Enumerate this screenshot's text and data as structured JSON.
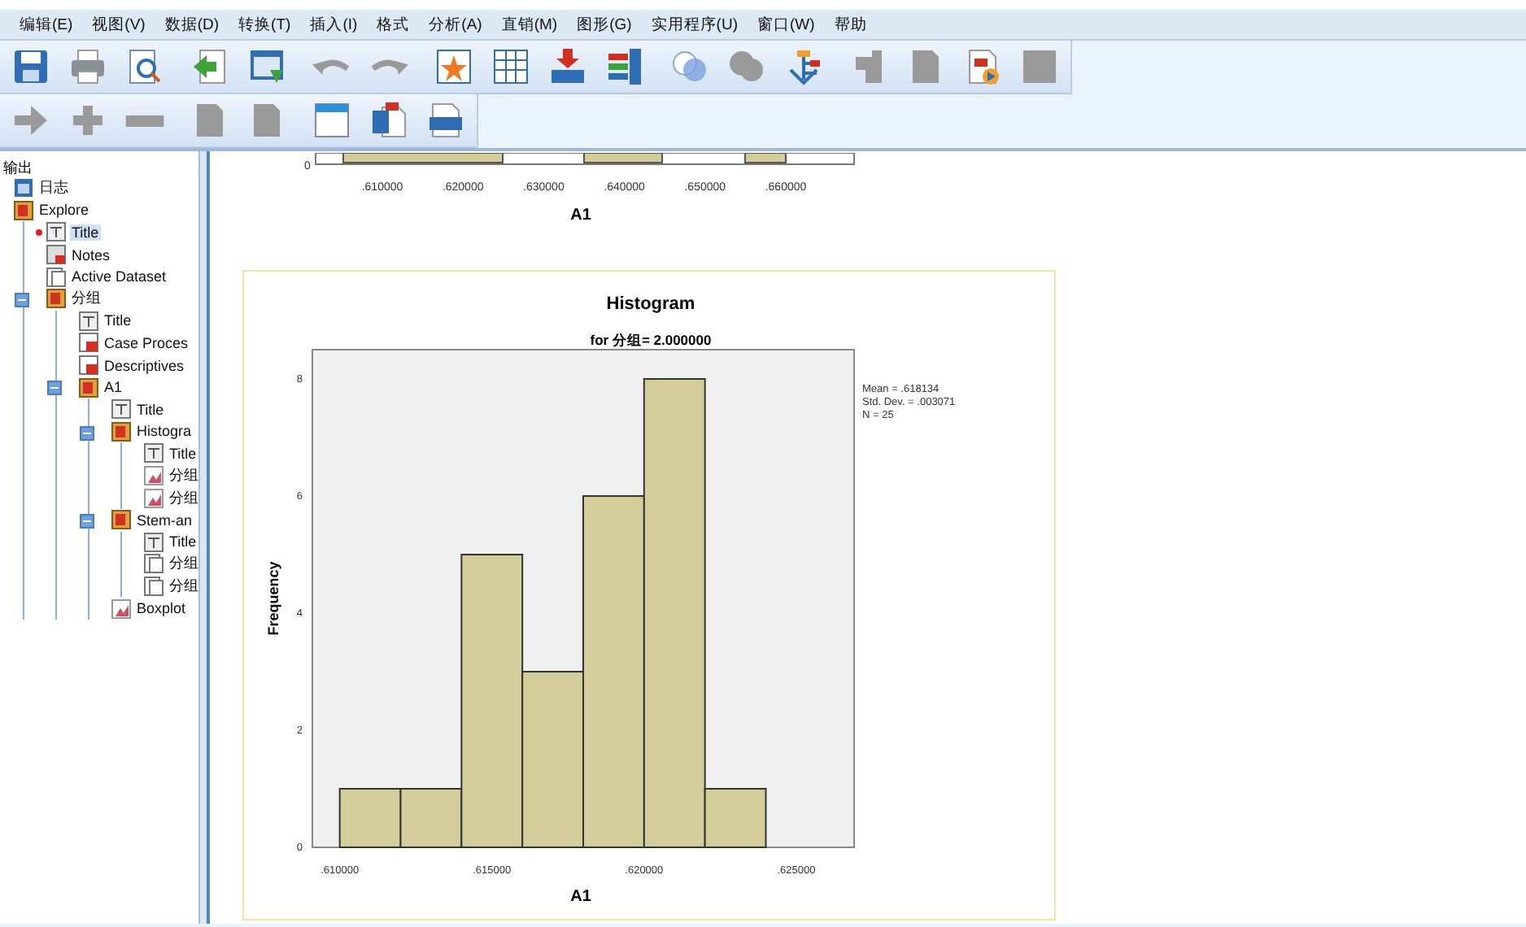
{
  "menu_bar": [
    "编辑(E)",
    "视图(V)",
    "数据(D)",
    "转换(T)",
    "插入(I)",
    "格式",
    "分析(A)",
    "直销(M)",
    "图形(G)",
    "实用程序(U)",
    "窗口(W)",
    "帮助"
  ],
  "toolbar_rows": [
    [
      [
        {
          "kind": "save",
          "disabled": false
        },
        {
          "kind": "print",
          "disabled": false
        },
        {
          "kind": "preview",
          "disabled": false
        }
      ],
      [
        {
          "kind": "export",
          "disabled": false
        },
        {
          "kind": "import",
          "disabled": false
        }
      ],
      [
        {
          "kind": "undo",
          "disabled": true
        },
        {
          "kind": "redo",
          "disabled": true
        }
      ],
      [
        {
          "kind": "star",
          "disabled": false
        },
        {
          "kind": "grid",
          "disabled": false
        },
        {
          "kind": "insert",
          "disabled": false
        },
        {
          "kind": "columns",
          "disabled": false
        }
      ],
      [
        {
          "kind": "circles",
          "disabled": false
        },
        {
          "kind": "circles",
          "disabled": true
        },
        {
          "kind": "tree",
          "disabled": false
        }
      ],
      [
        {
          "kind": "block",
          "disabled": true
        },
        {
          "kind": "doc",
          "disabled": true
        },
        {
          "kind": "docplay",
          "disabled": false
        },
        {
          "kind": "square",
          "disabled": true
        }
      ]
    ],
    [
      [
        {
          "kind": "arrow",
          "disabled": true
        },
        {
          "kind": "plus",
          "disabled": true
        },
        {
          "kind": "minus",
          "disabled": true
        }
      ],
      [
        {
          "kind": "doc",
          "disabled": true
        },
        {
          "kind": "doc",
          "disabled": true
        }
      ],
      [
        {
          "kind": "window",
          "disabled": false
        },
        {
          "kind": "doct",
          "disabled": false
        },
        {
          "kind": "docbar",
          "disabled": false
        }
      ]
    ]
  ],
  "outline": {
    "root": "输出",
    "items": [
      {
        "label": "日志",
        "kind": "log",
        "selected": false
      },
      {
        "label": "Explore",
        "kind": "book",
        "selected": false,
        "children": [
          {
            "label": "Title",
            "kind": "title",
            "selected": true
          },
          {
            "label": "Notes",
            "kind": "notes",
            "selected": false
          },
          {
            "label": "Active Dataset",
            "kind": "text",
            "selected": false
          },
          {
            "label": "分组",
            "kind": "book",
            "selected": false,
            "expanded": true,
            "children": [
              {
                "label": "Title",
                "kind": "title",
                "selected": false
              },
              {
                "label": "Case Proces",
                "kind": "table",
                "selected": false
              },
              {
                "label": "Descriptives",
                "kind": "table",
                "selected": false
              },
              {
                "label": "A1",
                "kind": "book",
                "selected": false,
                "expanded": true,
                "children": [
                  {
                    "label": "Title",
                    "kind": "title",
                    "selected": false
                  },
                  {
                    "label": "Histogra",
                    "kind": "book",
                    "selected": false,
                    "expanded": true,
                    "children": [
                      {
                        "label": "Title",
                        "kind": "title",
                        "selected": false
                      },
                      {
                        "label": "分组",
                        "kind": "chart",
                        "selected": false
                      },
                      {
                        "label": "分组",
                        "kind": "chart",
                        "selected": false
                      }
                    ]
                  },
                  {
                    "label": "Stem-an",
                    "kind": "book",
                    "selected": false,
                    "expanded": true,
                    "children": [
                      {
                        "label": "Title",
                        "kind": "title",
                        "selected": false
                      },
                      {
                        "label": "分组",
                        "kind": "text",
                        "selected": false
                      },
                      {
                        "label": "分组",
                        "kind": "text",
                        "selected": false
                      }
                    ]
                  },
                  {
                    "label": "Boxplot",
                    "kind": "chart",
                    "selected": false
                  }
                ]
              }
            ]
          }
        ]
      }
    ]
  },
  "boxplot_fragment": {
    "y_tick": "0",
    "tick_labels": [
      ".610000",
      ".620000",
      ".630000",
      ".640000",
      ".650000",
      ".660000"
    ],
    "axis_title": "A1"
  },
  "histogram": {
    "subtitle": "for 分组= 2.000000",
    "chart_data": {
      "type": "bar",
      "title": "Histogram",
      "xlabel": "A1",
      "ylabel": "Frequency",
      "x": [
        0.611,
        0.613,
        0.615,
        0.617,
        0.619,
        0.621,
        0.623
      ],
      "xlim": [
        0.6091,
        0.6269
      ],
      "ylim": [
        0,
        8.5
      ],
      "values": [
        1,
        1,
        5,
        3,
        6,
        8,
        1
      ],
      "xticks": [
        {
          "value": 0.61,
          "label": ".610000"
        },
        {
          "value": 0.615,
          "label": ".615000"
        },
        {
          "value": 0.62,
          "label": ".620000"
        },
        {
          "value": 0.625,
          "label": ".625000"
        }
      ],
      "yticks": [
        0,
        2,
        4,
        6,
        8
      ],
      "annotations": [
        "Mean = .618134",
        "Std. Dev. = .003071",
        "N = 25"
      ]
    }
  }
}
